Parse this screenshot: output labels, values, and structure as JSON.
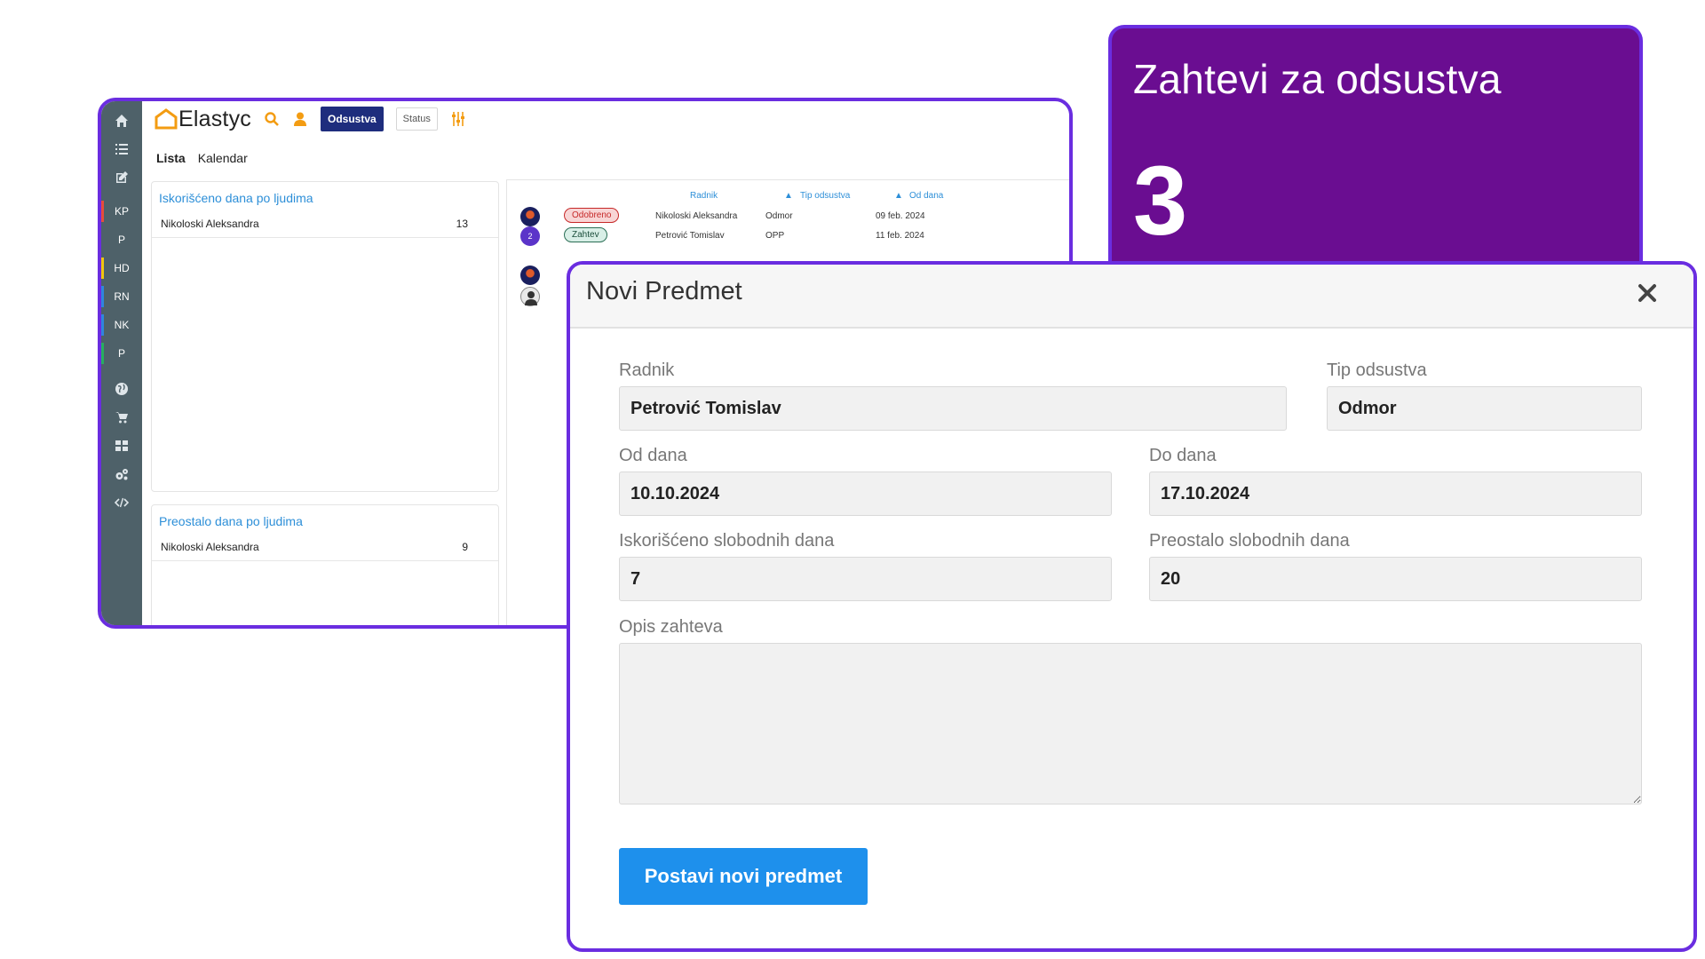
{
  "app": {
    "logo_text": "Elastyc",
    "buttons": {
      "odsustva": "Odsustva",
      "status": "Status"
    },
    "tabs": [
      {
        "label": "Lista",
        "active": true
      },
      {
        "label": "Kalendar",
        "active": false
      }
    ],
    "sidebar": {
      "icons": [
        "home-icon",
        "list-icon",
        "edit-icon"
      ],
      "items": [
        {
          "label": "KP",
          "color": "#e74c3c"
        },
        {
          "label": "P",
          "color": ""
        },
        {
          "label": "HD",
          "color": "#f1c40f"
        },
        {
          "label": "RN",
          "color": "#2e86de"
        },
        {
          "label": "NK",
          "color": "#2e86de"
        },
        {
          "label": "P",
          "color": "#27ae60"
        }
      ],
      "bottom_icons": [
        "globe-icon",
        "cart-icon",
        "grid-icon",
        "cogs-icon",
        "code-icon"
      ]
    },
    "used_days_card": {
      "title": "Iskorišćeno dana po ljudima",
      "rows": [
        {
          "name": "Nikoloski Aleksandra",
          "value": "13"
        }
      ]
    },
    "remaining_days_card": {
      "title": "Preostalo dana po ljudima",
      "rows": [
        {
          "name": "Nikoloski Aleksandra",
          "value": "9"
        }
      ]
    },
    "requests_list": {
      "columns": {
        "radnik": "Radnik",
        "tip": "Tip odsustva",
        "od": "Od dana"
      },
      "rows": [
        {
          "status": "Odobreno",
          "radnik": "Nikoloski Aleksandra",
          "tip": "Odmor",
          "od": "09 feb. 2024"
        },
        {
          "status": "Zahtev",
          "radnik": "Petrović Tomislav",
          "tip": "OPP",
          "od": "11 feb. 2024"
        }
      ],
      "avatar_count_label": "2"
    }
  },
  "stat_card": {
    "title": "Zahtevi za odsustva",
    "value": "3",
    "color": "#6a0d91"
  },
  "modal": {
    "title": "Novi Predmet",
    "fields": {
      "radnik": {
        "label": "Radnik",
        "value": "Petrović Tomislav"
      },
      "tip_odsustva": {
        "label": "Tip odsustva",
        "value": "Odmor"
      },
      "od_dana": {
        "label": "Od dana",
        "value": "10.10.2024"
      },
      "do_dana": {
        "label": "Do dana",
        "value": "17.10.2024"
      },
      "iskorisceno": {
        "label": "Iskorišćeno slobodnih dana",
        "value": "7"
      },
      "preostalo": {
        "label": "Preostalo slobodnih dana",
        "value": "20"
      },
      "opis": {
        "label": "Opis zahteva",
        "value": ""
      }
    },
    "submit_label": "Postavi novi predmet"
  },
  "colors": {
    "accent_border": "#6a2de0",
    "primary_button": "#1e90ec",
    "nav_button": "#1e2d7d",
    "link": "#2d8fd8",
    "sidebar": "#4e6169"
  }
}
